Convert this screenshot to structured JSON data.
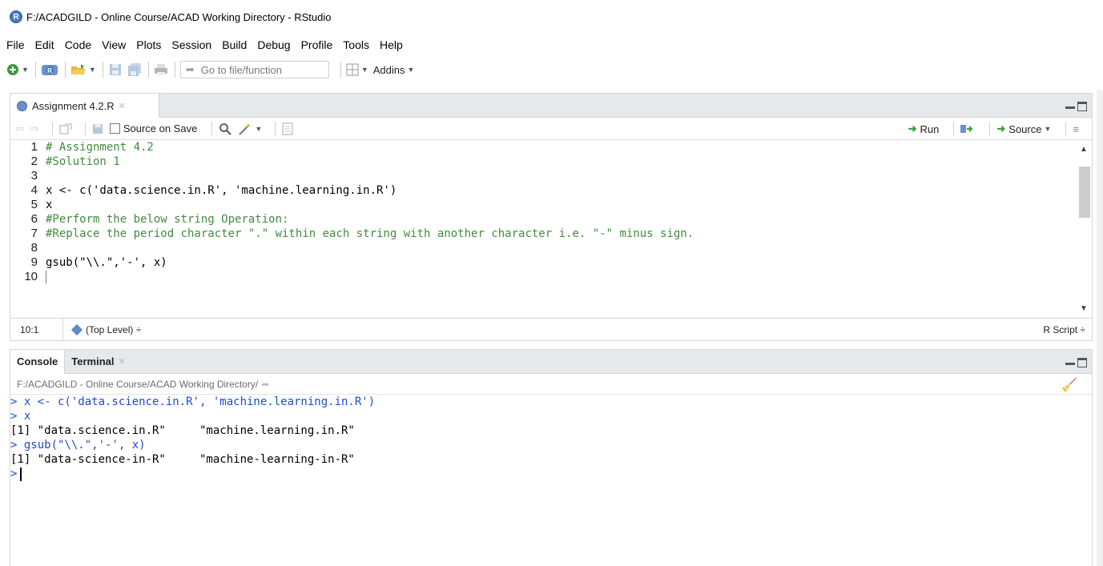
{
  "window": {
    "title": "F:/ACADGILD - Online Course/ACAD Working Directory - RStudio",
    "logo_letter": "R"
  },
  "menu": [
    "File",
    "Edit",
    "Code",
    "View",
    "Plots",
    "Session",
    "Build",
    "Debug",
    "Profile",
    "Tools",
    "Help"
  ],
  "toolbar": {
    "goto_placeholder": "Go to file/function",
    "addins_label": "Addins"
  },
  "editor": {
    "tab_label": "Assignment 4.2.R",
    "source_on_save_label": "Source on Save",
    "run_label": "Run",
    "source_label": "Source",
    "lines": [
      {
        "n": "1",
        "text": "# Assignment 4.2",
        "kind": "comment"
      },
      {
        "n": "2",
        "text": "#Solution 1",
        "kind": "comment"
      },
      {
        "n": "3",
        "text": "",
        "kind": "code"
      },
      {
        "n": "4",
        "text": "x <- c('data.science.in.R', 'machine.learning.in.R')",
        "kind": "code"
      },
      {
        "n": "5",
        "text": "x",
        "kind": "code"
      },
      {
        "n": "6",
        "text": "#Perform the below string Operation:",
        "kind": "comment"
      },
      {
        "n": "7",
        "text": "#Replace the period character \".\" within each string with another character i.e. \"-\" minus sign.",
        "kind": "comment"
      },
      {
        "n": "8",
        "text": "",
        "kind": "code"
      },
      {
        "n": "9",
        "text": "gsub(\"\\\\.\",'-', x)",
        "kind": "code"
      },
      {
        "n": "10",
        "text": "",
        "kind": "code"
      }
    ],
    "status": {
      "position": "10:1",
      "level": "(Top Level) ÷",
      "script_type": "R Script ÷"
    }
  },
  "console": {
    "tabs": [
      "Console",
      "Terminal"
    ],
    "path": "F:/ACADGILD - Online Course/ACAD Working Directory/",
    "lines": [
      {
        "text": "> x <- c('data.science.in.R', 'machine.learning.in.R')",
        "kind": "input"
      },
      {
        "text": "> x",
        "kind": "input"
      },
      {
        "text": "[1] \"data.science.in.R\"     \"machine.learning.in.R\"",
        "kind": "output"
      },
      {
        "text": "> gsub(\"\\\\.\",'-', x)",
        "kind": "input"
      },
      {
        "text": "[1] \"data-science-in-R\"     \"machine-learning-in-R\"",
        "kind": "output"
      }
    ],
    "prompt": ">"
  }
}
